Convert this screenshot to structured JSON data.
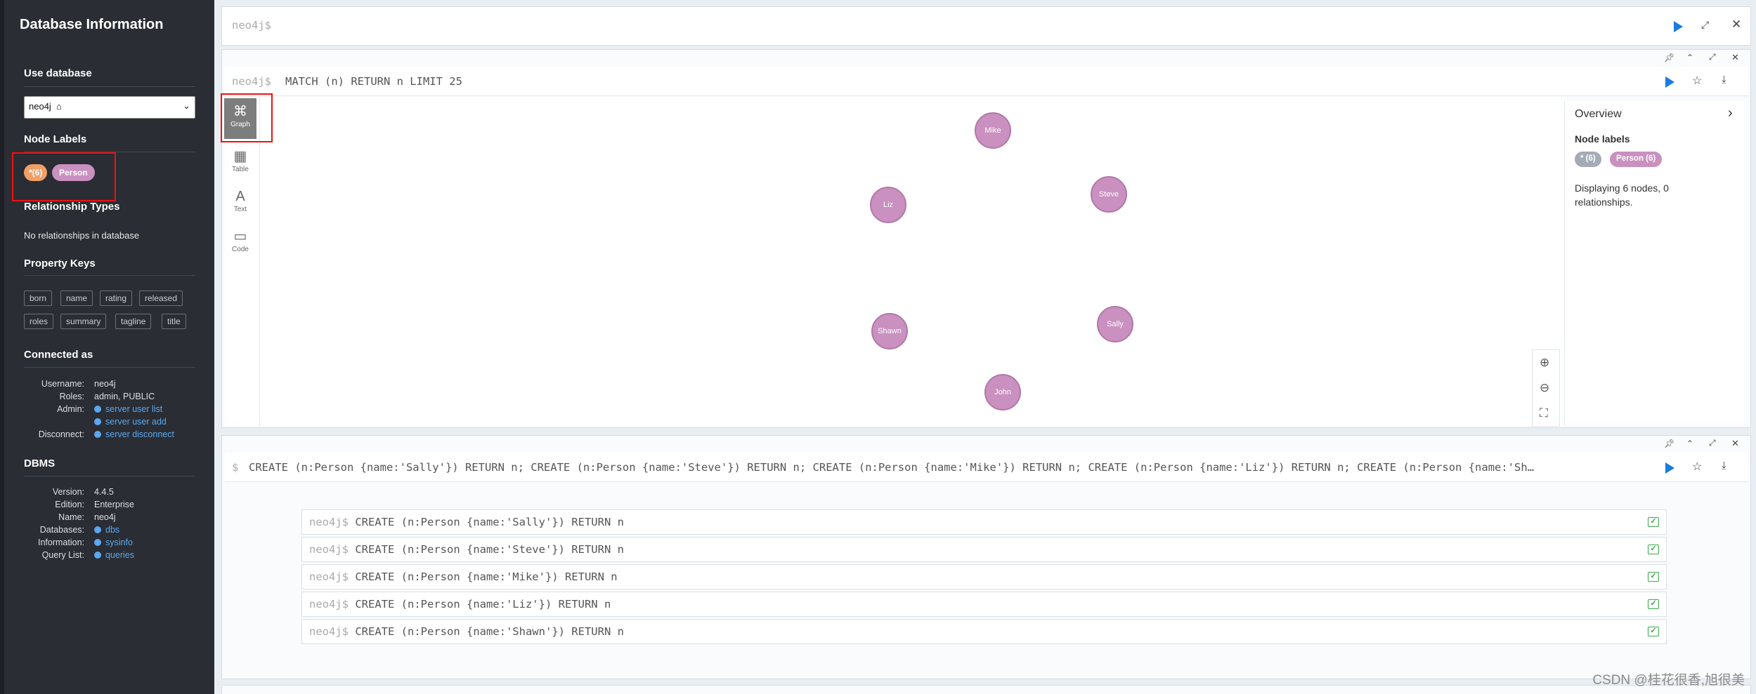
{
  "sidebar": {
    "title": "Database Information",
    "use_database_heading": "Use database",
    "database_value": "neo4j",
    "node_labels_heading": "Node Labels",
    "node_labels": [
      "*(6)",
      "Person"
    ],
    "relationship_types_heading": "Relationship Types",
    "relationship_types_text": "No relationships in database",
    "property_keys_heading": "Property Keys",
    "property_keys": [
      "born",
      "name",
      "rating",
      "released",
      "roles",
      "summary",
      "tagline",
      "title"
    ],
    "connected_heading": "Connected as",
    "connected": {
      "username_label": "Username:",
      "username": "neo4j",
      "roles_label": "Roles:",
      "roles": "admin, PUBLIC",
      "admin_label": "Admin:",
      "admin_link1": "server user list",
      "admin_link2": "server user add",
      "disconnect_label": "Disconnect:",
      "disconnect_link": "server disconnect"
    },
    "dbms_heading": "DBMS",
    "dbms": {
      "version_label": "Version:",
      "version": "4.4.5",
      "edition_label": "Edition:",
      "edition": "Enterprise",
      "name_label": "Name:",
      "name": "neo4j",
      "databases_label": "Databases:",
      "databases_link": "dbs",
      "information_label": "Information:",
      "information_link": "sysinfo",
      "querylist_label": "Query List:",
      "querylist_link": "queries"
    }
  },
  "editor": {
    "prompt": "neo4j$",
    "value": ""
  },
  "frame1": {
    "prompt": "neo4j$",
    "query": "MATCH (n) RETURN n LIMIT 25",
    "tools": [
      "Graph",
      "Table",
      "Text",
      "Code"
    ],
    "nodes": [
      "Mike",
      "Steve",
      "Liz",
      "Shawn",
      "Sally",
      "John"
    ],
    "overview": {
      "title": "Overview",
      "labels_heading": "Node labels",
      "labels": [
        "* (6)",
        "Person (6)"
      ],
      "summary": "Displaying 6 nodes, 0 relationships."
    }
  },
  "frame2": {
    "prompt": "$",
    "query": "CREATE (n:Person {name:'Sally'}) RETURN n; CREATE (n:Person {name:'Steve'}) RETURN n; CREATE (n:Person {name:'Mike'}) RETURN n; CREATE (n:Person {name:'Liz'}) RETURN n; CREATE (n:Person {name:'Sh…",
    "rows": [
      {
        "prompt": "neo4j$",
        "cmd": "CREATE (n:Person {name:'Sally'}) RETURN n"
      },
      {
        "prompt": "neo4j$",
        "cmd": "CREATE (n:Person {name:'Steve'}) RETURN n"
      },
      {
        "prompt": "neo4j$",
        "cmd": "CREATE (n:Person {name:'Mike'}) RETURN n"
      },
      {
        "prompt": "neo4j$",
        "cmd": "CREATE (n:Person {name:'Liz'}) RETURN n"
      },
      {
        "prompt": "neo4j$",
        "cmd": "CREATE (n:Person {name:'Shawn'}) RETURN n"
      }
    ]
  },
  "watermark": "CSDN @桂花很香,旭很美",
  "colors": {
    "sidebar_bg": "#2a2d33",
    "node": "#c990c0",
    "accent": "#1a7be0",
    "label_all": "#f0a068"
  }
}
